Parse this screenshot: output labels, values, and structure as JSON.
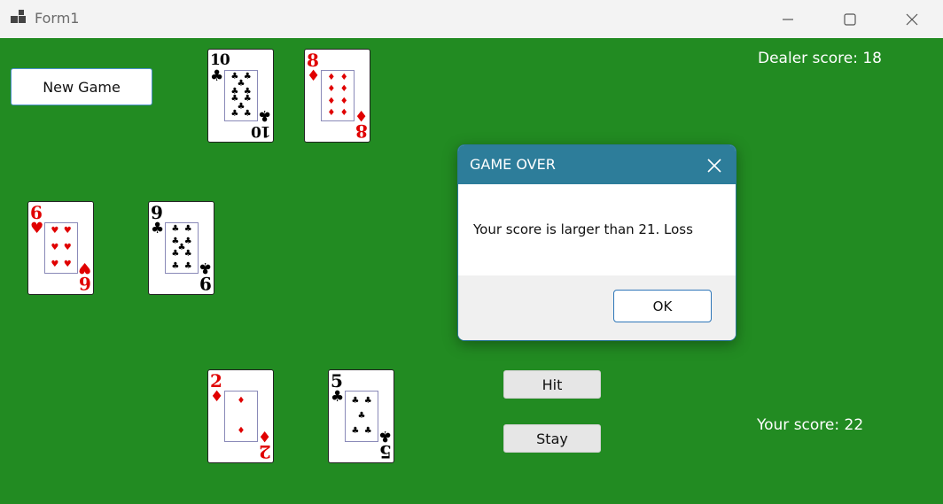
{
  "window": {
    "title": "Form1",
    "icon": "app-icon",
    "controls": [
      "minimize-icon",
      "maximize-icon",
      "close-icon"
    ]
  },
  "colors": {
    "table_green": "#228B22",
    "card_red": "#e00000",
    "card_black": "#000000",
    "dialog_header": "#2d7d9a"
  },
  "toolbar": {
    "new_game_label": "New Game"
  },
  "dealer": {
    "score_text": "Dealer score: 18",
    "cards": [
      {
        "rank": "10",
        "suit": "♣",
        "suit_name": "clubs"
      },
      {
        "rank": "8",
        "suit": "♦",
        "suit_name": "diamonds"
      }
    ]
  },
  "middle_cards": [
    {
      "rank": "6",
      "suit": "♥",
      "suit_name": "hearts"
    },
    {
      "rank": "9",
      "suit": "♣",
      "suit_name": "clubs"
    }
  ],
  "player": {
    "score_text": "Your score: 22",
    "cards": [
      {
        "rank": "2",
        "suit": "♦",
        "suit_name": "diamonds"
      },
      {
        "rank": "5",
        "suit": "♣",
        "suit_name": "clubs"
      }
    ]
  },
  "actions": {
    "hit_label": "Hit",
    "stay_label": "Stay"
  },
  "dialog": {
    "title": "GAME OVER",
    "message": "Your score is larger than 21. Loss",
    "ok_label": "OK",
    "close_icon": "close-icon"
  }
}
